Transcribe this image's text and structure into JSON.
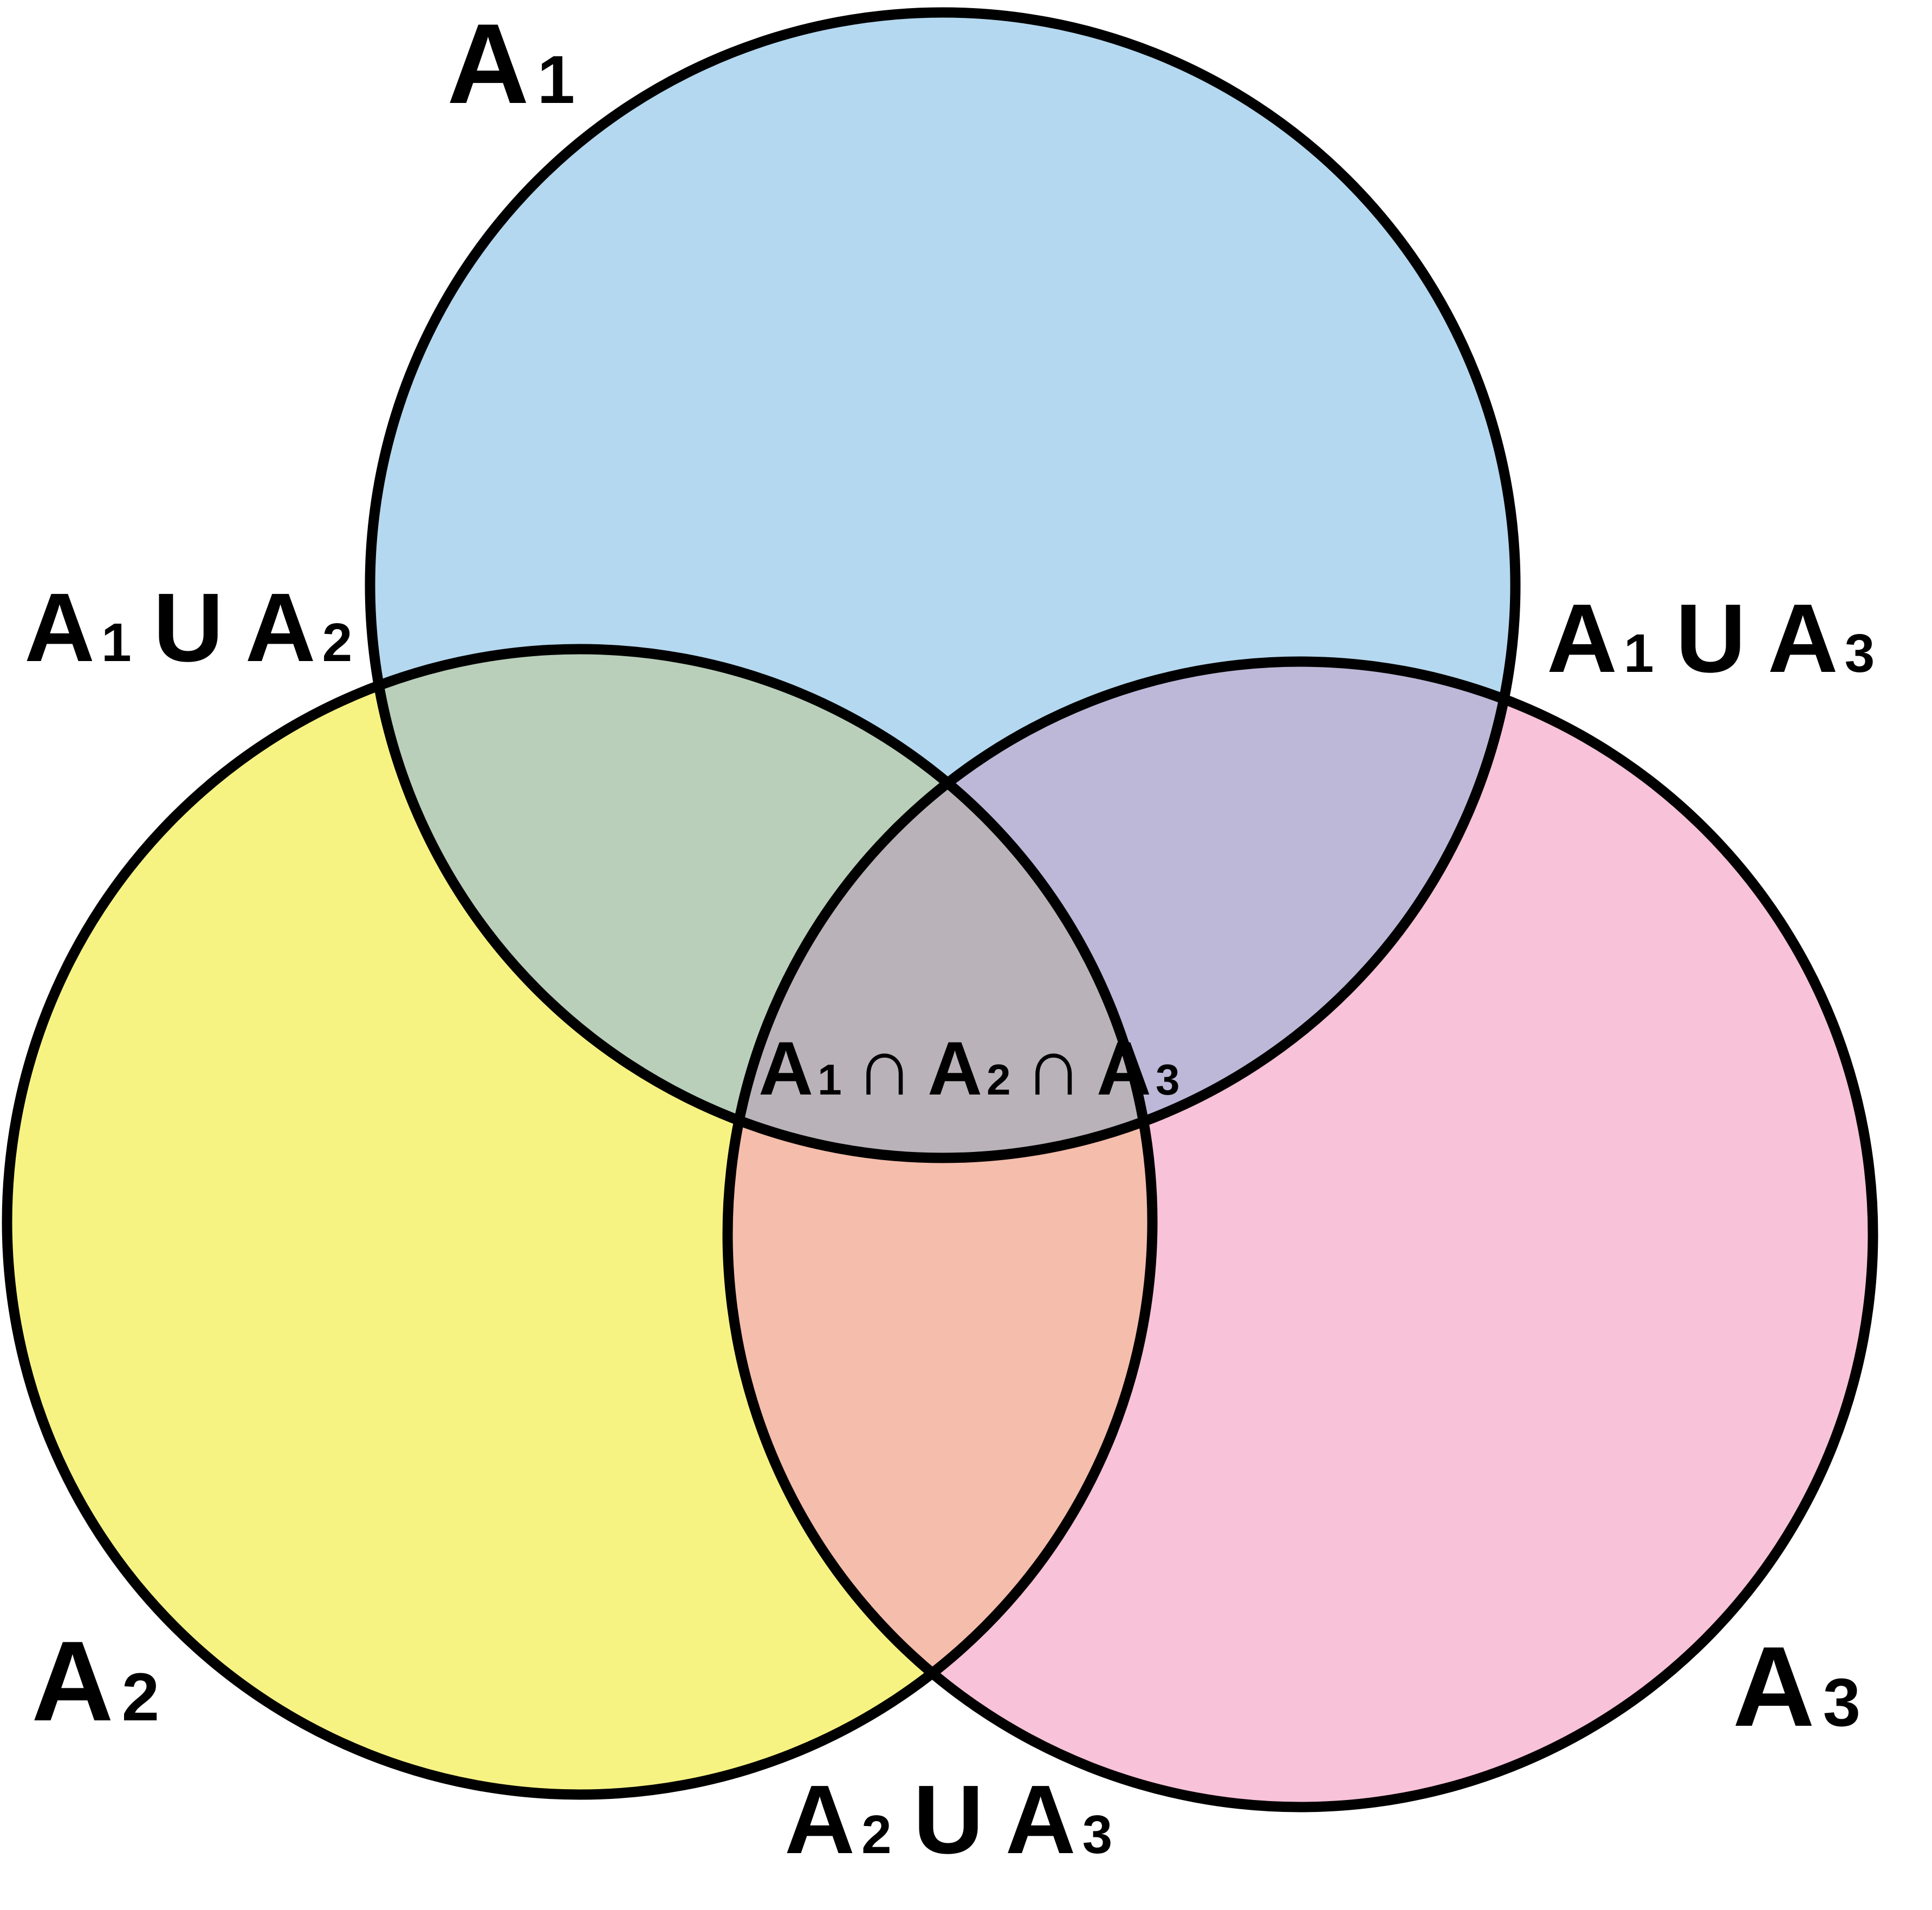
{
  "diagram": {
    "sets": [
      {
        "id": "A1",
        "name": "A",
        "sub": "1",
        "color": "#b4d8ef"
      },
      {
        "id": "A2",
        "name": "A",
        "sub": "2",
        "color": "#f7f383"
      },
      {
        "id": "A3",
        "name": "A",
        "sub": "3",
        "color": "#f8c2d9"
      }
    ],
    "overlap_colors": {
      "A1_A2": "#b9cfba",
      "A1_A3": "#bdb8d8",
      "A2_A3": "#f5bdab",
      "A1_A2_A3": "#bab2b9"
    },
    "labels": {
      "a1": {
        "a": "A",
        "s": "1"
      },
      "a2": {
        "a": "A",
        "s": "2"
      },
      "a3": {
        "a": "A",
        "s": "3"
      },
      "a1_union_a2": {
        "a1": "A",
        "s1": "1",
        "op": "U",
        "a2": "A",
        "s2": "2"
      },
      "a1_union_a3": {
        "a1": "A",
        "s1": "1",
        "op": "U",
        "a2": "A",
        "s2": "3"
      },
      "a2_union_a3": {
        "a1": "A",
        "s1": "2",
        "op": "U",
        "a2": "A",
        "s2": "3"
      },
      "a1_int_a2_int_a3": {
        "a1": "A",
        "s1": "1",
        "op1": "∩",
        "a2": "A",
        "s2": "2",
        "op2": "∩",
        "a3": "A",
        "s3": "3"
      }
    }
  }
}
